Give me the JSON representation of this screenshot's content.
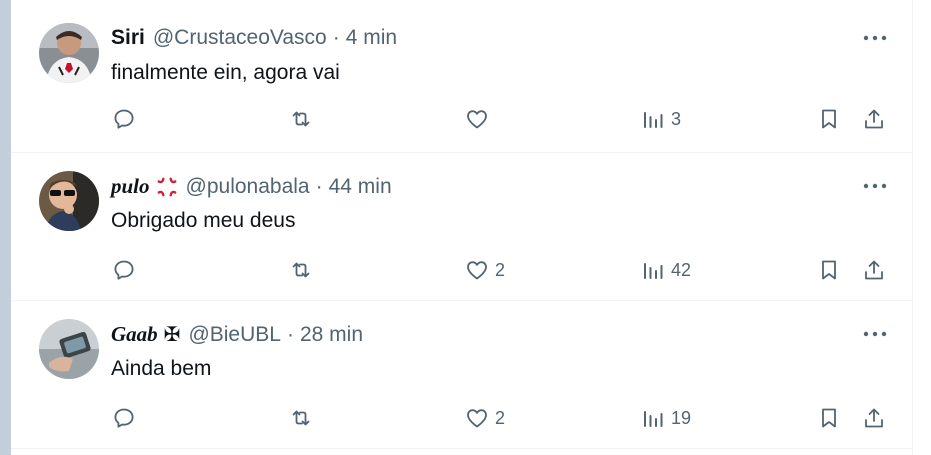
{
  "colors": {
    "text": "#0f1419",
    "secondary": "#536471",
    "divider": "#eff3f4",
    "strip": "#c2cfdb",
    "angry": "#d61f3a"
  },
  "tweets": [
    {
      "display_name": "Siri",
      "handle": "@CrustaceoVasco",
      "separator": "·",
      "time": "4 min",
      "text": "finalmente ein, agora vai",
      "reply_count": "",
      "retweet_count": "",
      "like_count": "",
      "view_count": "3"
    },
    {
      "display_name": "pulo",
      "name_emoji": "anger-symbol-icon",
      "handle": "@pulonabala",
      "separator": "·",
      "time": "44 min",
      "text": "Obrigado meu deus",
      "reply_count": "",
      "retweet_count": "",
      "like_count": "2",
      "view_count": "42"
    },
    {
      "display_name": "Gaab",
      "name_emoji": "maltese-cross-icon",
      "name_symbol": "✠",
      "handle": "@BieUBL",
      "separator": "·",
      "time": "28 min",
      "text": "Ainda bem",
      "reply_count": "",
      "retweet_count": "",
      "like_count": "2",
      "view_count": "19"
    }
  ]
}
